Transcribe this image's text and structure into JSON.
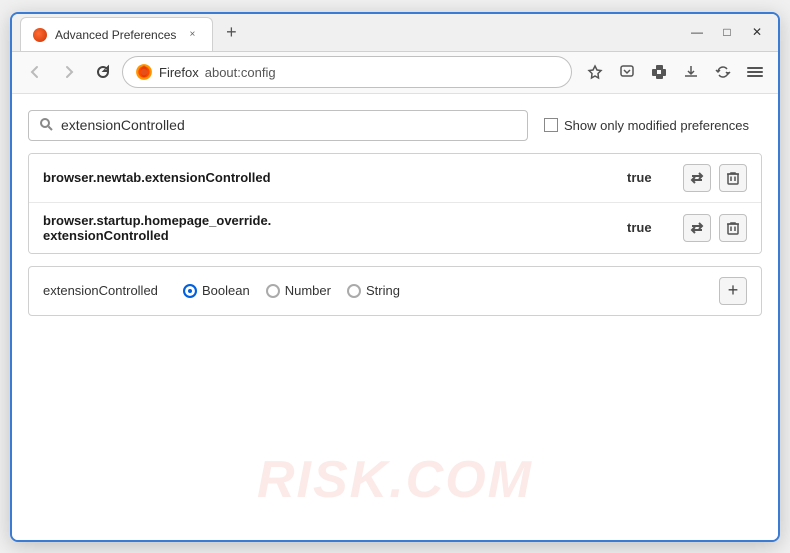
{
  "window": {
    "title": "Advanced Preferences",
    "tab_close": "×",
    "new_tab": "+",
    "win_minimize": "—",
    "win_maximize": "□",
    "win_close": "✕"
  },
  "navbar": {
    "back_label": "←",
    "forward_label": "→",
    "reload_label": "↻",
    "browser_name": "Firefox",
    "url": "about:config",
    "bookmark_icon": "☆",
    "pocket_icon": "⊙",
    "extension_icon": "🧩",
    "download_icon": "⬇",
    "sync_icon": "⟳",
    "menu_icon": "≡"
  },
  "search": {
    "placeholder": "extensionControlled",
    "value": "extensionControlled",
    "show_modified_label": "Show only modified preferences"
  },
  "results": [
    {
      "name": "browser.newtab.extensionControlled",
      "value": "true"
    },
    {
      "name": "browser.startup.homepage_override.\nextensionControlled",
      "name_line1": "browser.startup.homepage_override.",
      "name_line2": "extensionControlled",
      "value": "true",
      "multiline": true
    }
  ],
  "add_preference": {
    "name": "extensionControlled",
    "type_options": [
      {
        "label": "Boolean",
        "selected": true
      },
      {
        "label": "Number",
        "selected": false
      },
      {
        "label": "String",
        "selected": false
      }
    ],
    "add_label": "+"
  },
  "watermark": "RISK.COM"
}
